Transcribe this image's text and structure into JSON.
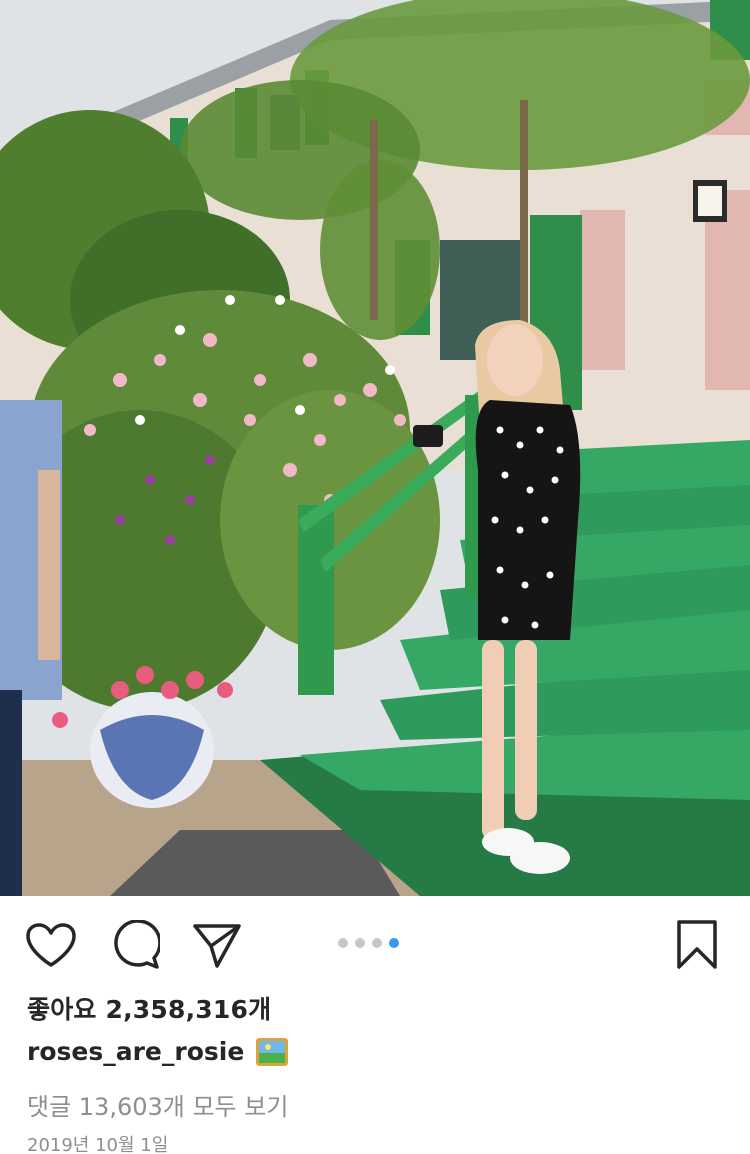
{
  "post": {
    "likes_text": "좋아요 2,358,316개",
    "username": "roses_are_rosie",
    "caption_emoji": "framed-picture-emoji",
    "comments_text": "댓글 13,603개 모두 보기",
    "date_text": "2019년 10월 1일"
  },
  "carousel": {
    "total": 4,
    "active_index": 4,
    "active_color": "#3897f0",
    "inactive_color": "#c7c7c7"
  },
  "icons": {
    "like": "heart-icon",
    "comment": "comment-bubble-icon",
    "share": "paper-plane-icon",
    "save": "bookmark-icon"
  },
  "photo": {
    "subject": "woman in polka-dot dress on green garden stairs",
    "colors": {
      "stairs": "#2e9a5c",
      "shutters": "#2f8f4a",
      "wall": "#e9dfd4",
      "pink_wall": "#e3b7b1"
    }
  }
}
